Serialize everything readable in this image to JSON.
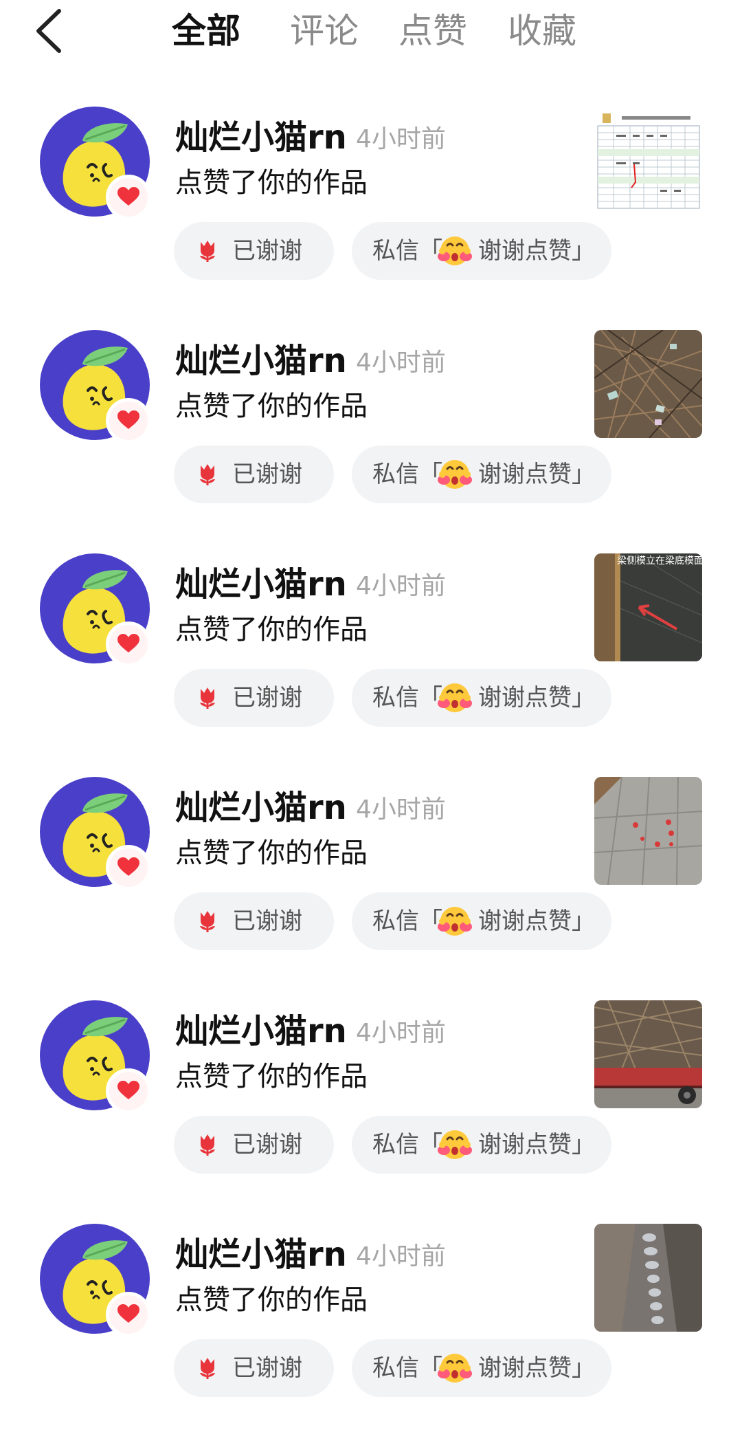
{
  "header": {
    "tabs": [
      "全部",
      "评论",
      "点赞",
      "收藏"
    ],
    "active_tab": "全部",
    "back_icon": "chevron-left-icon"
  },
  "colors": {
    "active_tab": "#111111",
    "inactive_tab": "#8a8a8a",
    "timestamp": "#a6a6a6",
    "pill_bg": "#f2f3f5",
    "heart": "#f0323c",
    "avatar_bg": "#4a3fc9",
    "avatar_lemon": "#f5e03c"
  },
  "notifications": [
    {
      "username": "灿烂小猫rn",
      "time": "4小时前",
      "action": "点赞了你的作品",
      "thanked_label": "已谢谢",
      "dm_prefix": "私信「",
      "dm_text": "谢谢点赞」",
      "thumbnail": "table-document-thumbnail"
    },
    {
      "username": "灿烂小猫rn",
      "time": "4小时前",
      "action": "点赞了你的作品",
      "thanked_label": "已谢谢",
      "dm_prefix": "私信「",
      "dm_text": "谢谢点赞」",
      "thumbnail": "rebar-debris-thumbnail"
    },
    {
      "username": "灿烂小猫rn",
      "time": "4小时前",
      "action": "点赞了你的作品",
      "thanked_label": "已谢谢",
      "dm_prefix": "私信「",
      "dm_text": "谢谢点赞」",
      "thumbnail": "beam-formwork-thumbnail",
      "thumbnail_caption": "梁侧模立在梁底模面"
    },
    {
      "username": "灿烂小猫rn",
      "time": "4小时前",
      "action": "点赞了你的作品",
      "thanked_label": "已谢谢",
      "dm_prefix": "私信「",
      "dm_text": "谢谢点赞」",
      "thumbnail": "concrete-marked-thumbnail"
    },
    {
      "username": "灿烂小猫rn",
      "time": "4小时前",
      "action": "点赞了你的作品",
      "thanked_label": "已谢谢",
      "dm_prefix": "私信「",
      "dm_text": "谢谢点赞」",
      "thumbnail": "rebar-truck-thumbnail"
    },
    {
      "username": "灿烂小猫rn",
      "time": "4小时前",
      "action": "点赞了你的作品",
      "thanked_label": "已谢谢",
      "dm_prefix": "私信「",
      "dm_text": "谢谢点赞」",
      "thumbnail": "weld-seam-thumbnail"
    }
  ]
}
